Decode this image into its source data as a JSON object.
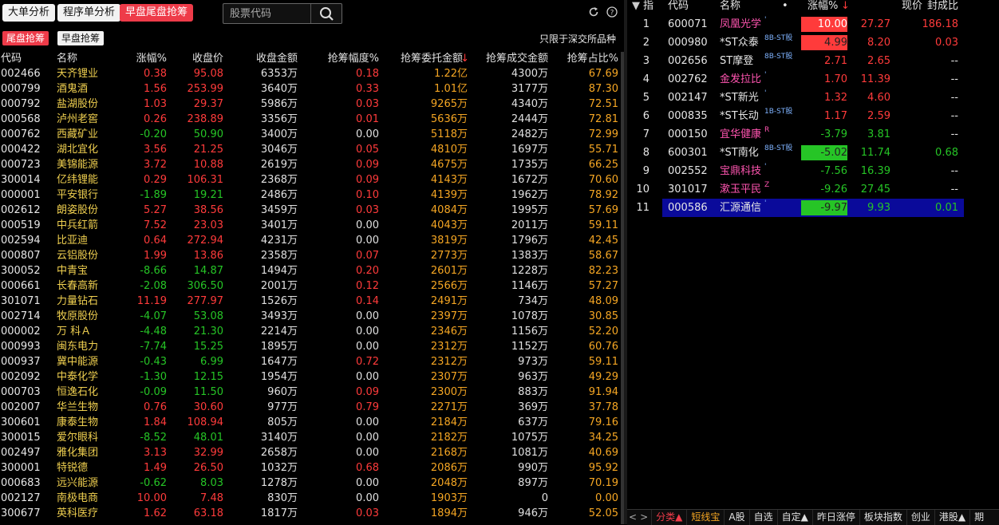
{
  "top_buttons": [
    "大单分析",
    "程序单分析",
    "早盘尾盘抢筹"
  ],
  "search": {
    "placeholder": "股票代码"
  },
  "sub_buttons": [
    "尾盘抢筹",
    "早盘抢筹"
  ],
  "note": "只限于深交所品种",
  "icons": {
    "search": "search-icon",
    "refresh": "refresh-icon",
    "help": "help-icon"
  },
  "colors": {
    "up": "#ff3b3b",
    "down": "#26c526",
    "accent": "#ee3b49",
    "name": "#f0d050",
    "selected": "#0a0a9a"
  },
  "left_table": {
    "headers": [
      "代码",
      "名称",
      "涨幅%",
      "收盘价",
      "收盘金额",
      "抢筹幅度%",
      "抢筹委托金额",
      "抢筹成交金额",
      "抢筹占比%"
    ],
    "sort_indicator": "↓",
    "rows": [
      [
        "002466",
        "天齐锂业",
        "0.38",
        "95.08",
        "6353万",
        "0.18",
        "1.22亿",
        "4300万",
        "67.69"
      ],
      [
        "000799",
        "酒鬼酒",
        "1.56",
        "253.99",
        "3640万",
        "0.33",
        "1.01亿",
        "3177万",
        "87.30"
      ],
      [
        "000792",
        "盐湖股份",
        "1.03",
        "29.37",
        "5986万",
        "0.03",
        "9265万",
        "4340万",
        "72.51"
      ],
      [
        "000568",
        "泸州老窖",
        "0.26",
        "238.89",
        "3356万",
        "0.01",
        "5636万",
        "2444万",
        "72.81"
      ],
      [
        "000762",
        "西藏矿业",
        "-0.20",
        "50.90",
        "3400万",
        "0.00",
        "5118万",
        "2482万",
        "72.99"
      ],
      [
        "000422",
        "湖北宜化",
        "3.56",
        "21.25",
        "3046万",
        "0.05",
        "4810万",
        "1697万",
        "55.71"
      ],
      [
        "000723",
        "美锦能源",
        "3.72",
        "10.88",
        "2619万",
        "0.09",
        "4675万",
        "1735万",
        "66.25"
      ],
      [
        "300014",
        "亿纬锂能",
        "0.29",
        "106.31",
        "2368万",
        "0.09",
        "4143万",
        "1672万",
        "70.60"
      ],
      [
        "000001",
        "平安银行",
        "-1.89",
        "19.21",
        "2486万",
        "0.10",
        "4139万",
        "1962万",
        "78.92"
      ],
      [
        "002612",
        "朗姿股份",
        "5.27",
        "38.56",
        "3459万",
        "0.03",
        "4084万",
        "1995万",
        "57.69"
      ],
      [
        "000519",
        "中兵红箭",
        "7.52",
        "23.03",
        "3401万",
        "0.00",
        "4043万",
        "2011万",
        "59.11"
      ],
      [
        "002594",
        "比亚迪",
        "0.64",
        "272.94",
        "4231万",
        "0.00",
        "3819万",
        "1796万",
        "42.45"
      ],
      [
        "000807",
        "云铝股份",
        "1.99",
        "13.86",
        "2358万",
        "0.07",
        "2773万",
        "1383万",
        "58.67"
      ],
      [
        "300052",
        "中青宝",
        "-8.66",
        "14.87",
        "1494万",
        "0.20",
        "2601万",
        "1228万",
        "82.23"
      ],
      [
        "000661",
        "长春高新",
        "-2.08",
        "306.50",
        "2001万",
        "0.12",
        "2566万",
        "1146万",
        "57.27"
      ],
      [
        "301071",
        "力量钻石",
        "11.19",
        "277.97",
        "1526万",
        "0.14",
        "2491万",
        "734万",
        "48.09"
      ],
      [
        "002714",
        "牧原股份",
        "-4.07",
        "53.08",
        "3493万",
        "0.00",
        "2397万",
        "1078万",
        "30.85"
      ],
      [
        "000002",
        "万 科Ａ",
        "-4.48",
        "21.30",
        "2214万",
        "0.00",
        "2346万",
        "1156万",
        "52.20"
      ],
      [
        "000993",
        "闽东电力",
        "-7.74",
        "15.25",
        "1895万",
        "0.00",
        "2312万",
        "1152万",
        "60.76"
      ],
      [
        "000937",
        "冀中能源",
        "-0.43",
        "6.99",
        "1647万",
        "0.72",
        "2312万",
        "973万",
        "59.11"
      ],
      [
        "002092",
        "中泰化学",
        "-1.30",
        "12.15",
        "1954万",
        "0.00",
        "2307万",
        "963万",
        "49.29"
      ],
      [
        "000703",
        "恒逸石化",
        "-0.09",
        "11.50",
        "960万",
        "0.09",
        "2300万",
        "883万",
        "91.94"
      ],
      [
        "002007",
        "华兰生物",
        "0.76",
        "30.60",
        "977万",
        "0.79",
        "2271万",
        "369万",
        "37.78"
      ],
      [
        "300601",
        "康泰生物",
        "1.84",
        "108.94",
        "805万",
        "0.00",
        "2184万",
        "637万",
        "79.16"
      ],
      [
        "300015",
        "爱尔眼科",
        "-8.52",
        "48.01",
        "3140万",
        "0.00",
        "2182万",
        "1075万",
        "34.25"
      ],
      [
        "002497",
        "雅化集团",
        "3.13",
        "32.99",
        "2658万",
        "0.00",
        "2168万",
        "1081万",
        "40.69"
      ],
      [
        "300001",
        "特锐德",
        "1.49",
        "26.50",
        "1032万",
        "0.68",
        "2086万",
        "990万",
        "95.92"
      ],
      [
        "000683",
        "远兴能源",
        "-0.62",
        "8.03",
        "1278万",
        "0.00",
        "2048万",
        "897万",
        "70.19"
      ],
      [
        "002127",
        "南极电商",
        "10.00",
        "7.48",
        "830万",
        "0.00",
        "1903万",
        "0",
        "0.00"
      ],
      [
        "300677",
        "英科医疗",
        "1.62",
        "63.18",
        "1817万",
        "0.03",
        "1894万",
        "946万",
        "52.05"
      ]
    ]
  },
  "right_table": {
    "headers": [
      "指",
      "代码",
      "名称",
      "•",
      "涨幅%",
      "现价",
      "封成比"
    ],
    "sort_indicator": "↓",
    "rows": [
      {
        "n": "1",
        "code": "600071",
        "name": "凤凰光学",
        "tag": "'",
        "pct": "10.00",
        "price": "27.27",
        "ratio": "186.18",
        "bg": "#ff3b3b",
        "pctcolor": "#fff"
      },
      {
        "n": "2",
        "code": "000980",
        "name": "*ST众泰",
        "tag": "8B-ST股",
        "pct": "4.99",
        "price": "8.20",
        "ratio": "0.03",
        "bg": "#ff3b3b",
        "pctcolor": "#222"
      },
      {
        "n": "3",
        "code": "002656",
        "name": "ST摩登",
        "tag": "8B-ST股",
        "pct": "2.71",
        "price": "2.65",
        "ratio": "--",
        "bg": "",
        "pctcolor": "#ff3b3b"
      },
      {
        "n": "4",
        "code": "002762",
        "name": "金发拉比",
        "tag": "'",
        "pct": "1.70",
        "price": "11.39",
        "ratio": "--",
        "bg": "",
        "pctcolor": "#ff3b3b"
      },
      {
        "n": "5",
        "code": "002147",
        "name": "*ST新光",
        "tag": "'",
        "pct": "1.32",
        "price": "4.60",
        "ratio": "--",
        "bg": "",
        "pctcolor": "#ff3b3b"
      },
      {
        "n": "6",
        "code": "000835",
        "name": "*ST长动",
        "tag": "1B-ST股",
        "pct": "1.17",
        "price": "2.59",
        "ratio": "--",
        "bg": "",
        "pctcolor": "#ff3b3b"
      },
      {
        "n": "7",
        "code": "000150",
        "name": "宜华健康",
        "tag": "R",
        "pct": "-3.79",
        "price": "3.81",
        "ratio": "--",
        "bg": "",
        "pctcolor": "#26c526"
      },
      {
        "n": "8",
        "code": "600301",
        "name": "*ST南化",
        "tag": "8B-ST股",
        "pct": "-5.02",
        "price": "11.74",
        "ratio": "0.68",
        "bg": "#26c526",
        "pctcolor": "#222"
      },
      {
        "n": "9",
        "code": "002552",
        "name": "宝鼎科技",
        "tag": "'",
        "pct": "-7.56",
        "price": "16.39",
        "ratio": "--",
        "bg": "",
        "pctcolor": "#26c526"
      },
      {
        "n": "10",
        "code": "301017",
        "name": "漱玉平民",
        "tag": "Z",
        "pct": "-9.26",
        "price": "27.45",
        "ratio": "--",
        "bg": "",
        "pctcolor": "#26c526"
      },
      {
        "n": "11",
        "code": "000586",
        "name": "汇源通信",
        "tag": "'",
        "pct": "-9.97",
        "price": "9.93",
        "ratio": "0.01",
        "bg": "#26c526",
        "pctcolor": "#222"
      }
    ]
  },
  "bottom_tabs": [
    "<",
    ">",
    "分类▲",
    "短线宝",
    "A股",
    "自选",
    "自定▲",
    "昨日涨停",
    "板块指数",
    "创业",
    "港股▲",
    "期"
  ]
}
